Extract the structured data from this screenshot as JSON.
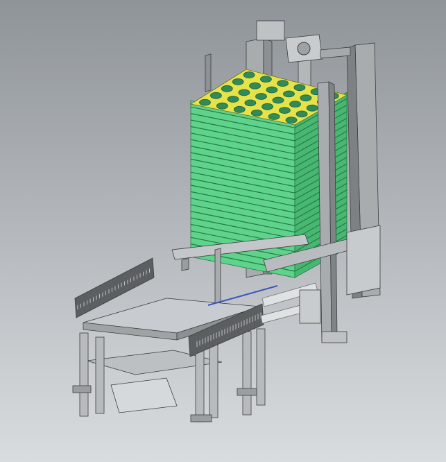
{
  "viewport": {
    "background_top": "#8f9499",
    "background_bottom": "#d9dcdf"
  },
  "model": {
    "tray_color": "#5fd38c",
    "tray_top_color": "#e6e24a",
    "frame_color": "#a9acae",
    "plate_color": "#c8ccd0",
    "rail_color": "#5c5f62",
    "tray_layers": 24,
    "tray_pockets": {
      "rows": 5,
      "cols": 6
    }
  }
}
